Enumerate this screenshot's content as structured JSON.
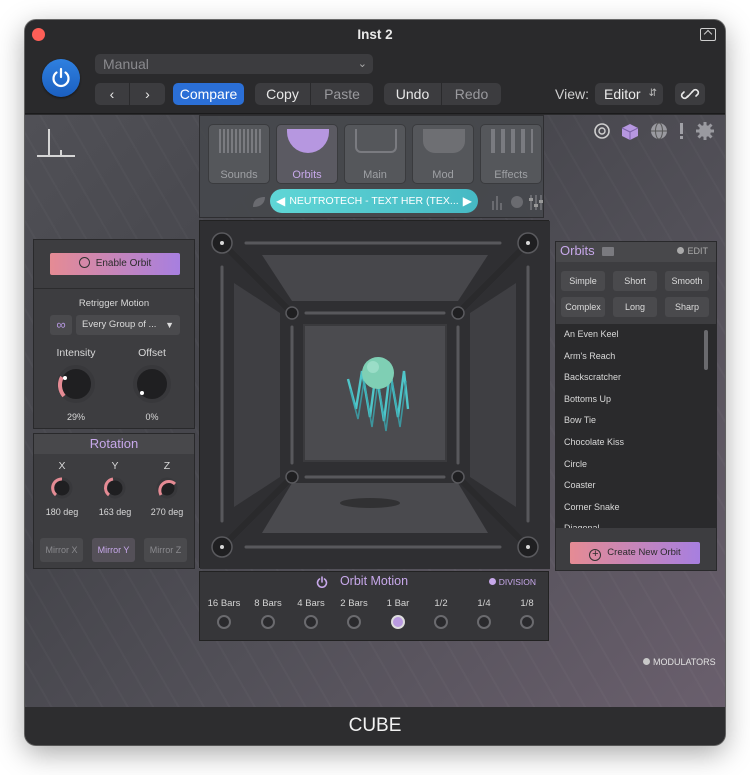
{
  "window": {
    "title": "Inst 2"
  },
  "toolbar": {
    "preset": "Manual",
    "compare": "Compare",
    "copy": "Copy",
    "paste": "Paste",
    "undo": "Undo",
    "redo": "Redo",
    "view_label": "View:",
    "view_value": "Editor"
  },
  "nav": {
    "tabs": [
      "Sounds",
      "Orbits",
      "Main",
      "Mod",
      "Effects"
    ],
    "active_tab": "Orbits",
    "preset_name": "NEUTROTECH - TEXT HER (TEX..."
  },
  "left_panel": {
    "enable_orbit": "Enable Orbit",
    "retrigger_label": "Retrigger Motion",
    "retrigger_value": "Every Group of ...",
    "intensity_label": "Intensity",
    "intensity_value": "29%",
    "offset_label": "Offset",
    "offset_value": "0%"
  },
  "rotation": {
    "title": "Rotation",
    "axes": [
      {
        "label": "X",
        "value": "180 deg"
      },
      {
        "label": "Y",
        "value": "163 deg"
      },
      {
        "label": "Z",
        "value": "270 deg"
      }
    ],
    "mirrors": [
      "Mirror X",
      "Mirror Y",
      "Mirror Z"
    ],
    "active_mirror": "Mirror Y"
  },
  "orbit_motion": {
    "title": "Orbit Motion",
    "division": "DIVISION",
    "steps": [
      "16 Bars",
      "8 Bars",
      "4 Bars",
      "2 Bars",
      "1 Bar",
      "1/2",
      "1/4",
      "1/8"
    ],
    "selected_step": "1 Bar"
  },
  "orbits_panel": {
    "title": "Orbits",
    "edit": "EDIT",
    "filters": [
      "Simple",
      "Short",
      "Smooth",
      "Complex",
      "Long",
      "Sharp"
    ],
    "list": [
      "An Even Keel",
      "Arm's Reach",
      "Backscratcher",
      "Bottoms Up",
      "Bow Tie",
      "Chocolate Kiss",
      "Circle",
      "Coaster",
      "Corner Snake",
      "Diagonal"
    ],
    "create_button": "Create New Orbit"
  },
  "modulators": "MODULATORS",
  "footer": {
    "label": "CUBE"
  },
  "colors": {
    "accent_blue": "#2b6fd6",
    "accent_purple": "#c7a8ea",
    "accent_teal": "#5fd6d6",
    "accent_pink": "#e58b94",
    "close_red": "#fe5f57"
  },
  "icons": [
    "power-icon",
    "chevron-left-icon",
    "chevron-right-icon",
    "link-icon",
    "pip-icon",
    "spiral-icon",
    "cube-icon",
    "globe-icon",
    "alert-icon",
    "gear-icon",
    "infinity-icon",
    "folder-icon",
    "plus-circle-icon",
    "left-arrow-icon",
    "right-arrow-icon",
    "save-icon",
    "meters-icon",
    "sliders-icon"
  ]
}
